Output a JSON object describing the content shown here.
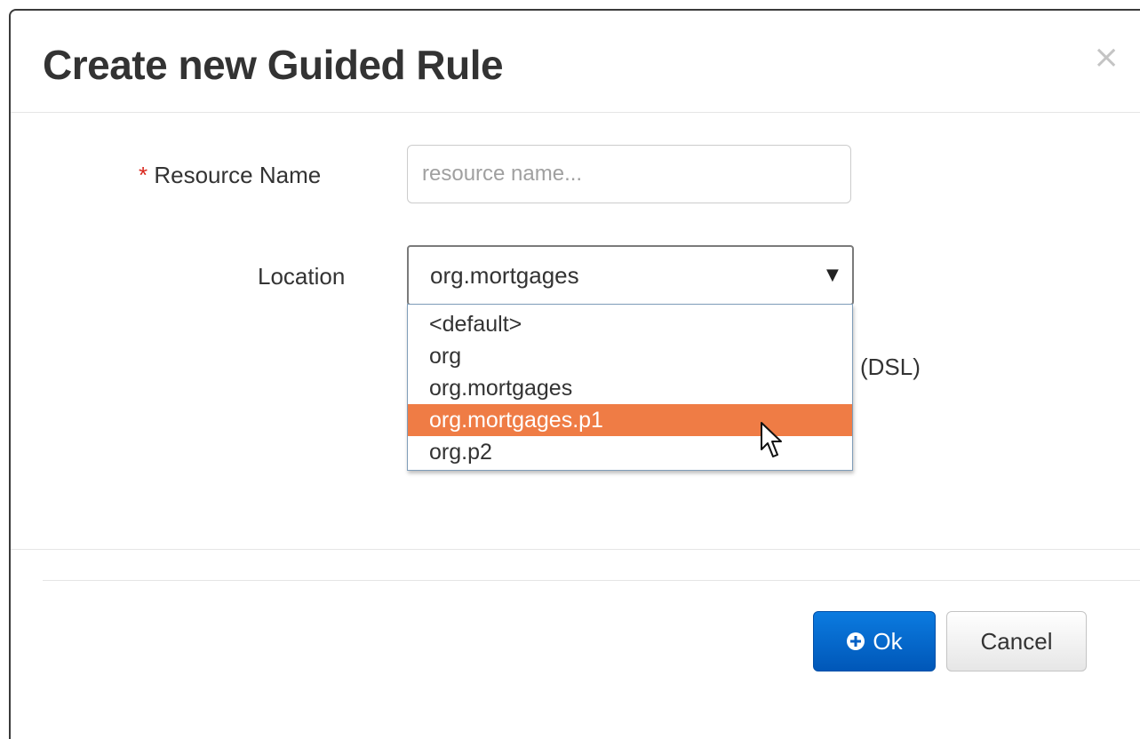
{
  "dialog": {
    "title": "Create new Guided Rule",
    "close_glyph": "×"
  },
  "form": {
    "resource_name": {
      "required_mark": "*",
      "label": "Resource Name",
      "placeholder": "resource name...",
      "value": ""
    },
    "location": {
      "label": "Location",
      "selected_value": "org.mortgages",
      "arrow_glyph": "▼",
      "options": [
        {
          "label": "<default>"
        },
        {
          "label": "org"
        },
        {
          "label": "org.mortgages"
        },
        {
          "label": "org.mortgages.p1",
          "highlighted": true
        },
        {
          "label": "org.p2"
        }
      ]
    },
    "partially_hidden_text": "(DSL)"
  },
  "footer": {
    "ok_label": "Ok",
    "cancel_label": "Cancel"
  },
  "icons": {
    "ok_icon": "plus-circle-icon",
    "close_icon": "close-icon",
    "cursor_icon": "mouse-pointer-icon"
  },
  "colors": {
    "highlight": "#ef7c45",
    "primary_button": "#0067cf",
    "required_star": "#d9261c"
  }
}
